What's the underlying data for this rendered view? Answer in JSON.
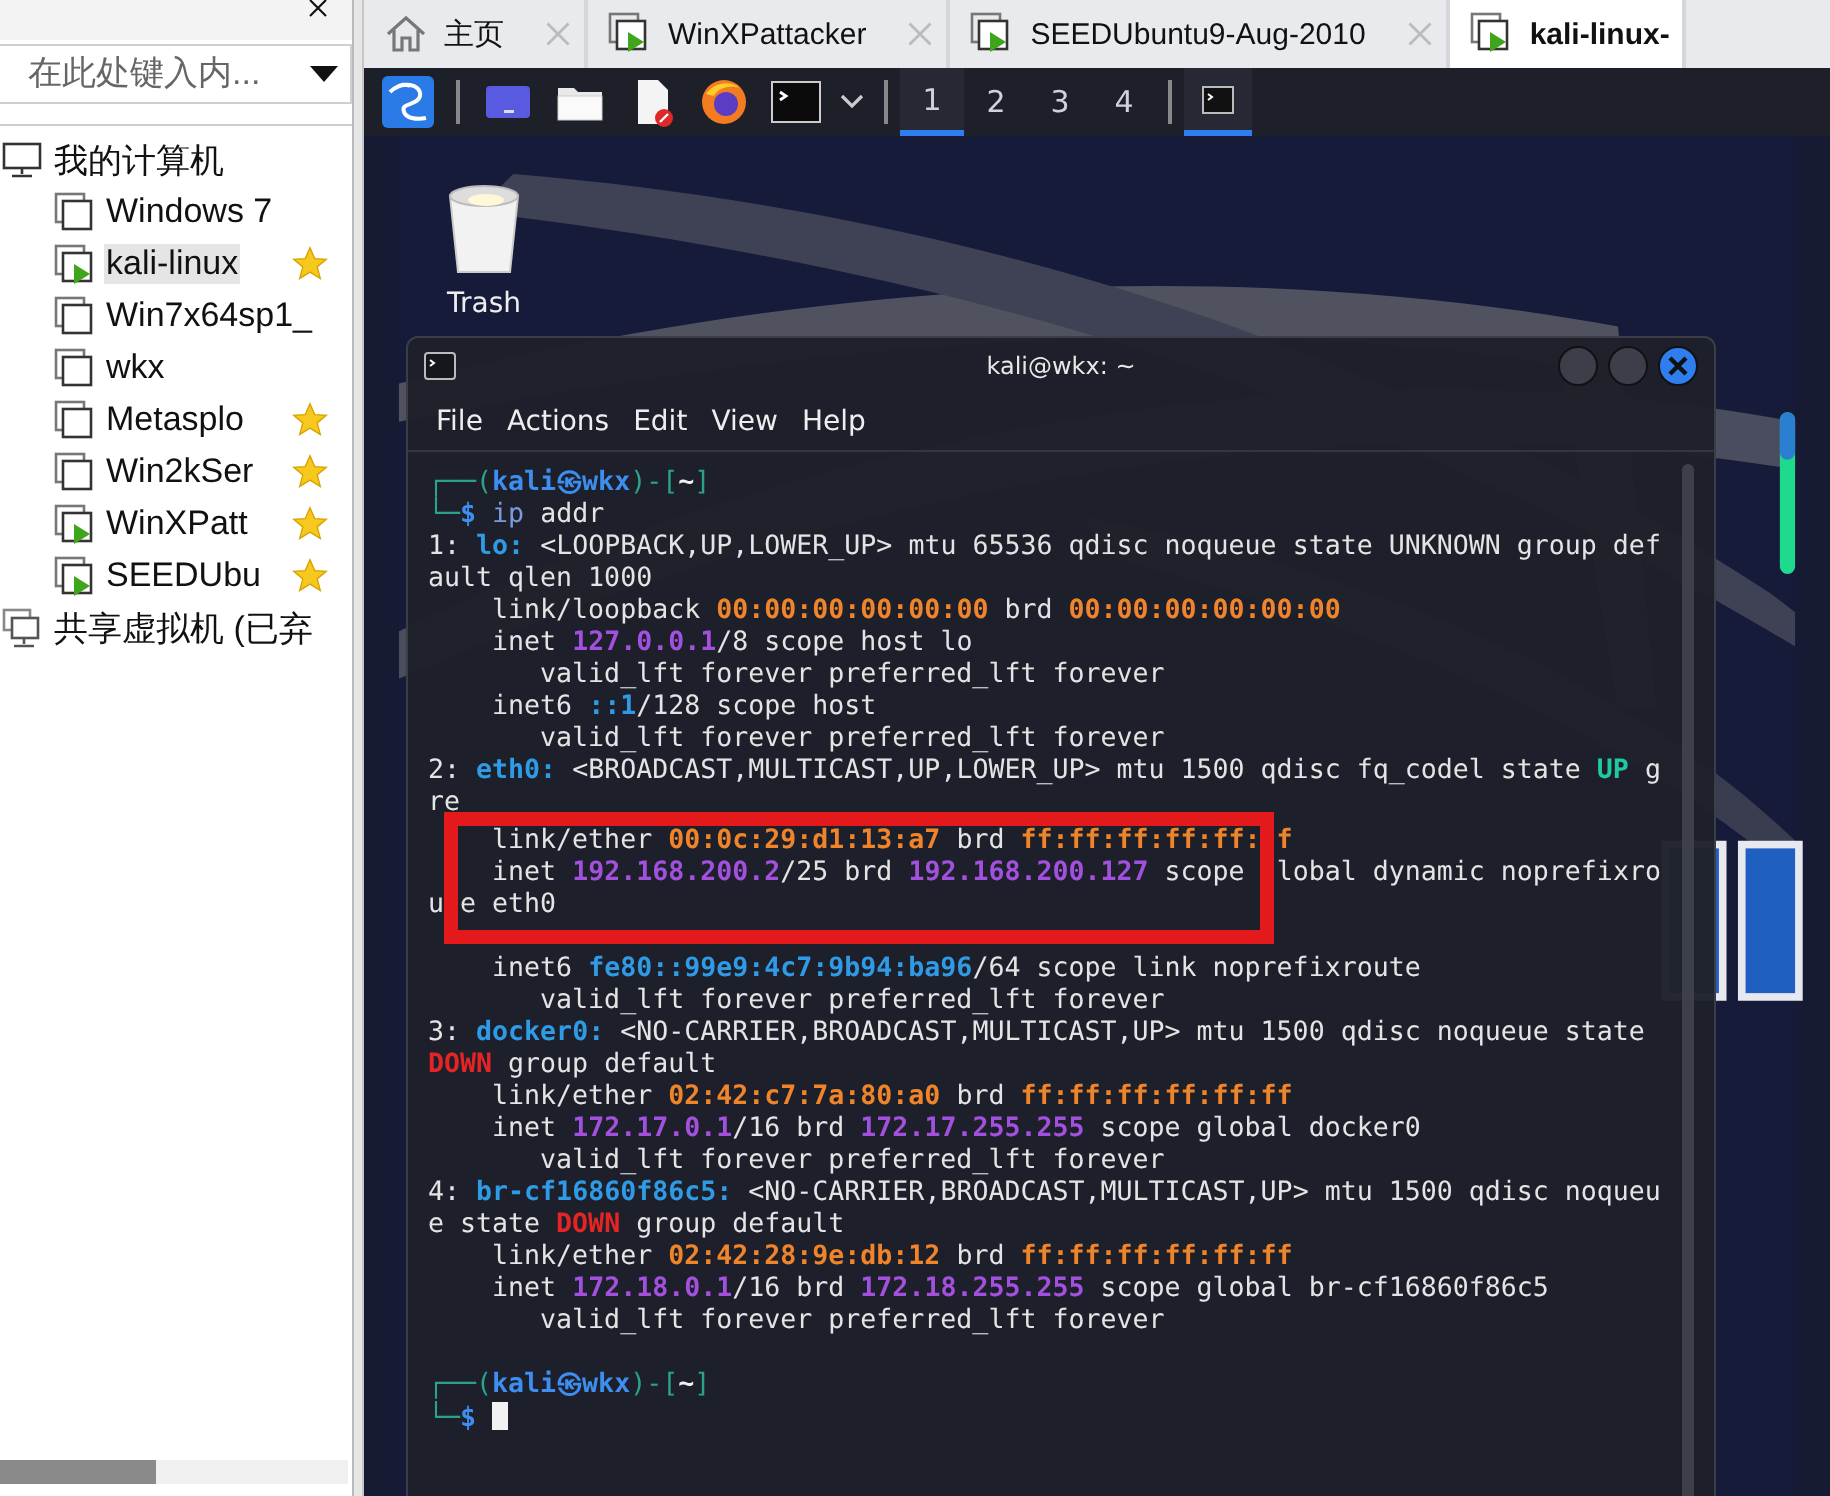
{
  "sidebar": {
    "search": {
      "placeholder": "在此处键入内..."
    },
    "tree": [
      {
        "label": "我的计算机",
        "kind": "computer",
        "children": [
          {
            "label": "Windows 7",
            "kind": "vm",
            "running": false,
            "favorite": false,
            "selected": false
          },
          {
            "label": "kali-linux",
            "kind": "vm",
            "running": true,
            "favorite": true,
            "selected": true
          },
          {
            "label": "Win7x64sp1_",
            "kind": "vm",
            "running": false,
            "favorite": false,
            "selected": false
          },
          {
            "label": "wkx",
            "kind": "vm",
            "running": false,
            "favorite": false,
            "selected": false
          },
          {
            "label": "Metasplo",
            "kind": "vm",
            "running": false,
            "favorite": true,
            "selected": false
          },
          {
            "label": "Win2kSer",
            "kind": "vm",
            "running": false,
            "favorite": true,
            "selected": false
          },
          {
            "label": "WinXPatt",
            "kind": "vm",
            "running": true,
            "favorite": true,
            "selected": false
          },
          {
            "label": "SEEDUbu",
            "kind": "vm",
            "running": true,
            "favorite": true,
            "selected": false
          }
        ]
      },
      {
        "label": "共享虚拟机 (已弃",
        "kind": "shared"
      }
    ]
  },
  "tabs": [
    {
      "label": "主页",
      "kind": "home",
      "selected": false,
      "closable": true
    },
    {
      "label": "WinXPattacker",
      "kind": "vm",
      "selected": false,
      "closable": true
    },
    {
      "label": "SEEDUbuntu9-Aug-2010",
      "kind": "vm",
      "selected": false,
      "closable": true
    },
    {
      "label": "kali-linux-",
      "kind": "vm",
      "selected": true,
      "closable": false
    }
  ],
  "guest": {
    "workspaces": [
      {
        "label": "1",
        "selected": true
      },
      {
        "label": "2",
        "selected": false
      },
      {
        "label": "3",
        "selected": false
      },
      {
        "label": "4",
        "selected": false
      }
    ],
    "desktop_icons": [
      {
        "label": "Trash"
      }
    ],
    "terminal": {
      "title": "kali@wkx: ~",
      "menu": [
        "File",
        "Actions",
        "Edit",
        "View",
        "Help"
      ],
      "lines": [
        {
          "segments": [
            {
              "text": "┌──(",
              "kind": "frame"
            },
            {
              "text": "kali㉿wkx",
              "kind": "user"
            },
            {
              "text": ")-[",
              "kind": "frame"
            },
            {
              "text": "~",
              "kind": "path"
            },
            {
              "text": "]",
              "kind": "frame"
            }
          ]
        },
        {
          "segments": [
            {
              "text": "└─",
              "kind": "frame"
            },
            {
              "text": "$",
              "kind": "user"
            },
            {
              "text": " ip",
              "kind": "cmd"
            },
            {
              "text": " addr",
              "kind": "plain"
            }
          ]
        },
        {
          "segments": [
            {
              "text": "1: ",
              "kind": "plain"
            },
            {
              "text": "lo:",
              "kind": "iface"
            },
            {
              "text": " <LOOPBACK,UP,LOWER_UP> mtu 65536 qdisc noqueue state UNKNOWN group def",
              "kind": "plain"
            }
          ]
        },
        {
          "segments": [
            {
              "text": "ault qlen 1000",
              "kind": "plain"
            }
          ]
        },
        {
          "segments": [
            {
              "text": "    link/loopback ",
              "kind": "plain"
            },
            {
              "text": "00:00:00:00:00:00",
              "kind": "mac"
            },
            {
              "text": " brd ",
              "kind": "plain"
            },
            {
              "text": "00:00:00:00:00:00",
              "kind": "mac"
            }
          ]
        },
        {
          "segments": [
            {
              "text": "    inet ",
              "kind": "plain"
            },
            {
              "text": "127.0.0.1",
              "kind": "ip"
            },
            {
              "text": "/8 scope host lo",
              "kind": "plain"
            }
          ]
        },
        {
          "segments": [
            {
              "text": "       valid_lft forever preferred_lft forever",
              "kind": "plain"
            }
          ]
        },
        {
          "segments": [
            {
              "text": "    inet6 ",
              "kind": "plain"
            },
            {
              "text": "::1",
              "kind": "ip6"
            },
            {
              "text": "/128 scope host",
              "kind": "plain"
            }
          ]
        },
        {
          "segments": [
            {
              "text": "       valid_lft forever preferred_lft forever",
              "kind": "plain"
            }
          ]
        },
        {
          "segments": [
            {
              "text": "2: ",
              "kind": "plain"
            },
            {
              "text": "eth0:",
              "kind": "iface"
            },
            {
              "text": " <BROADCAST,MULTICAST,UP,LOWER_UP> mtu 1500 qdisc fq_codel state ",
              "kind": "plain"
            },
            {
              "text": "UP",
              "kind": "up"
            },
            {
              "text": " g",
              "kind": "plain"
            }
          ]
        },
        {
          "segments": [
            {
              "text": "re",
              "kind": "plain"
            }
          ]
        },
        {
          "highlighted": true,
          "segments": [
            {
              "text": "    link/ether ",
              "kind": "plain"
            },
            {
              "text": "00:0c:29:d1:13:a7",
              "kind": "mac"
            },
            {
              "text": " brd ",
              "kind": "plain"
            },
            {
              "text": "ff:ff:ff:ff:ff: f",
              "kind": "mac"
            }
          ]
        },
        {
          "highlighted": true,
          "segments": [
            {
              "text": "    inet ",
              "kind": "plain"
            },
            {
              "text": "192.168.200.2",
              "kind": "ip"
            },
            {
              "text": "/25 brd ",
              "kind": "plain"
            },
            {
              "text": "192.168.200.127",
              "kind": "ip"
            },
            {
              "text": " scope  lobal dynamic noprefixro",
              "kind": "plain"
            }
          ]
        },
        {
          "highlighted": true,
          "segments": [
            {
              "text": "u e eth0",
              "kind": "plain"
            }
          ]
        },
        {
          "segments": [
            {
              "text": "    inet6 ",
              "kind": "plain"
            },
            {
              "text": "fe80::99e9:4c7:9b94:ba96",
              "kind": "ip6"
            },
            {
              "text": "/64 scope link noprefixroute",
              "kind": "plain"
            }
          ]
        },
        {
          "segments": [
            {
              "text": "       valid_lft forever preferred_lft forever",
              "kind": "plain"
            }
          ]
        },
        {
          "segments": [
            {
              "text": "3: ",
              "kind": "plain"
            },
            {
              "text": "docker0:",
              "kind": "iface"
            },
            {
              "text": " <NO-CARRIER,BROADCAST,MULTICAST,UP> mtu 1500 qdisc noqueue state",
              "kind": "plain"
            }
          ]
        },
        {
          "segments": [
            {
              "text": "DOWN",
              "kind": "down"
            },
            {
              "text": " group default",
              "kind": "plain"
            }
          ]
        },
        {
          "segments": [
            {
              "text": "    link/ether ",
              "kind": "plain"
            },
            {
              "text": "02:42:c7:7a:80:a0",
              "kind": "mac"
            },
            {
              "text": " brd ",
              "kind": "plain"
            },
            {
              "text": "ff:ff:ff:ff:ff:ff",
              "kind": "mac"
            }
          ]
        },
        {
          "segments": [
            {
              "text": "    inet ",
              "kind": "plain"
            },
            {
              "text": "172.17.0.1",
              "kind": "ip"
            },
            {
              "text": "/16 brd ",
              "kind": "plain"
            },
            {
              "text": "172.17.255.255",
              "kind": "ip"
            },
            {
              "text": " scope global docker0",
              "kind": "plain"
            }
          ]
        },
        {
          "segments": [
            {
              "text": "       valid_lft forever preferred_lft forever",
              "kind": "plain"
            }
          ]
        },
        {
          "segments": [
            {
              "text": "4: ",
              "kind": "plain"
            },
            {
              "text": "br-cf16860f86c5:",
              "kind": "iface"
            },
            {
              "text": " <NO-CARRIER,BROADCAST,MULTICAST,UP> mtu 1500 qdisc noqueu",
              "kind": "plain"
            }
          ]
        },
        {
          "segments": [
            {
              "text": "e state ",
              "kind": "plain"
            },
            {
              "text": "DOWN",
              "kind": "down"
            },
            {
              "text": " group default",
              "kind": "plain"
            }
          ]
        },
        {
          "segments": [
            {
              "text": "    link/ether ",
              "kind": "plain"
            },
            {
              "text": "02:42:28:9e:db:12",
              "kind": "mac"
            },
            {
              "text": " brd ",
              "kind": "plain"
            },
            {
              "text": "ff:ff:ff:ff:ff:ff",
              "kind": "mac"
            }
          ]
        },
        {
          "segments": [
            {
              "text": "    inet ",
              "kind": "plain"
            },
            {
              "text": "172.18.0.1",
              "kind": "ip"
            },
            {
              "text": "/16 brd ",
              "kind": "plain"
            },
            {
              "text": "172.18.255.255",
              "kind": "ip"
            },
            {
              "text": " scope global br-cf16860f86c5",
              "kind": "plain"
            }
          ]
        },
        {
          "segments": [
            {
              "text": "       valid_lft forever preferred_lft forever",
              "kind": "plain"
            }
          ]
        },
        {
          "blank_before": true,
          "segments": [
            {
              "text": "┌──(",
              "kind": "frame"
            },
            {
              "text": "kali㉿wkx",
              "kind": "user"
            },
            {
              "text": ")-[",
              "kind": "frame"
            },
            {
              "text": "~",
              "kind": "path"
            },
            {
              "text": "]",
              "kind": "frame"
            }
          ]
        },
        {
          "cursor": true,
          "segments": [
            {
              "text": "└─",
              "kind": "frame"
            },
            {
              "text": "$",
              "kind": "user"
            }
          ]
        }
      ]
    }
  }
}
